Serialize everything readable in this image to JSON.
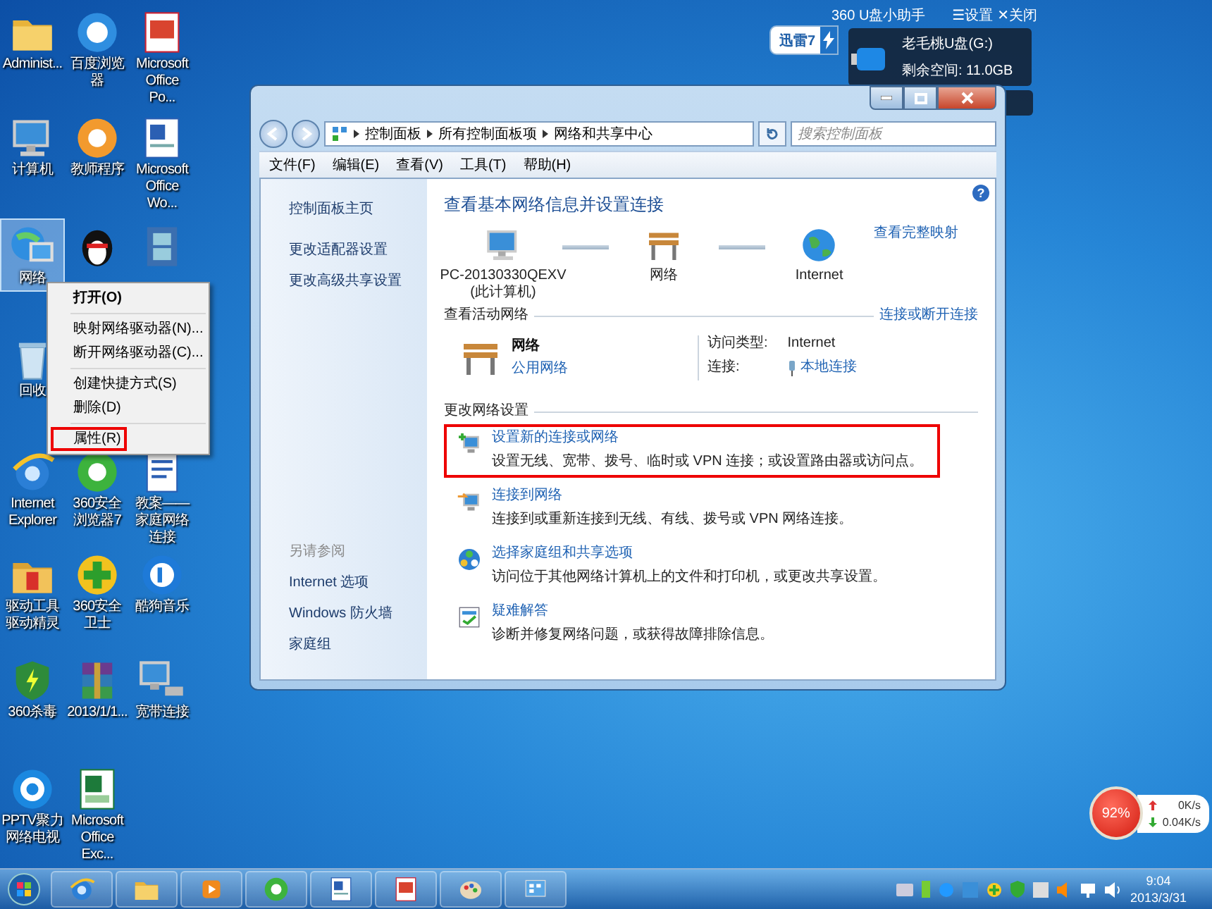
{
  "desktop_icons": [
    [
      {
        "label": "Administ...",
        "kind": "user-folder",
        "selected": false
      },
      {
        "label": "百度浏览器",
        "kind": "browser",
        "selected": false
      },
      {
        "label": "Microsoft Office Po...",
        "kind": "presentation",
        "selected": false
      }
    ],
    [
      {
        "label": "计算机",
        "kind": "computer",
        "selected": false
      },
      {
        "label": "教师程序",
        "kind": "app",
        "selected": false
      },
      {
        "label": "Microsoft Office Wo...",
        "kind": "word-document",
        "selected": false
      }
    ],
    [
      {
        "label": "网络",
        "kind": "network",
        "selected": true
      },
      {
        "kind": "qq",
        "selected": false
      },
      {
        "kind": "video",
        "selected": false
      }
    ],
    [
      {
        "label": "回收",
        "kind": "recycle-bin",
        "selected": false
      }
    ],
    [
      {
        "label": "Internet Explorer",
        "kind": "ie",
        "selected": false
      },
      {
        "label": "360安全浏览器7",
        "kind": "green-browser",
        "selected": false
      },
      {
        "label": "教案——家庭网络连接",
        "kind": "document",
        "selected": false
      }
    ],
    [
      {
        "label": "驱动工具驱动精灵",
        "kind": "driver-tool",
        "selected": false
      },
      {
        "label": "360安全卫士",
        "kind": "security",
        "selected": false
      },
      {
        "label": "酷狗音乐",
        "kind": "music",
        "selected": false
      }
    ],
    [
      {
        "label": "360杀毒",
        "kind": "antivirus",
        "selected": false
      },
      {
        "label": "2013/1/1...",
        "kind": "archive",
        "selected": false
      },
      {
        "label": "宽带连接",
        "kind": "broadband",
        "selected": false
      }
    ],
    [
      {
        "label": "PPTV聚力网络电视",
        "kind": "tv",
        "selected": false
      },
      {
        "label": "Microsoft Office Exc...",
        "kind": "spreadsheet",
        "selected": false
      }
    ]
  ],
  "context_menu": {
    "groups": [
      [
        {
          "label": "打开(O)",
          "default": true,
          "highlighted": false
        }
      ],
      [
        {
          "label": "映射网络驱动器(N)...",
          "default": false,
          "highlighted": false
        },
        {
          "label": "断开网络驱动器(C)...",
          "default": false,
          "highlighted": false
        }
      ],
      [
        {
          "label": "创建快捷方式(S)",
          "default": false,
          "highlighted": false
        },
        {
          "label": "删除(D)",
          "default": false,
          "highlighted": false
        }
      ],
      [
        {
          "label": "属性(R)",
          "default": false,
          "highlighted": true
        }
      ]
    ]
  },
  "window": {
    "breadcrumb": [
      "控制面板",
      "所有控制面板项",
      "网络和共享中心"
    ],
    "search": {
      "placeholder": "搜索控制面板"
    },
    "menu": [
      "文件(F)",
      "编辑(E)",
      "查看(V)",
      "工具(T)",
      "帮助(H)"
    ],
    "help_button": "?",
    "sidebar": {
      "links": [
        "控制面板主页",
        "更改适配器设置",
        "更改高级共享设置"
      ],
      "see_also_title": "另请参阅",
      "see_also": [
        "Internet 选项",
        "Windows 防火墙",
        "家庭组"
      ]
    },
    "heading": "查看基本网络信息并设置连接",
    "network_map": {
      "nodes": [
        {
          "kind": "computer",
          "label": "PC-20130330QEXV",
          "sublabel": "(此计算机)"
        },
        {
          "kind": "bench",
          "label": "网络"
        },
        {
          "kind": "globe",
          "label": "Internet"
        }
      ],
      "link": "查看完整映射"
    },
    "active_networks": {
      "title": "查看活动网络",
      "link": "连接或断开连接",
      "name": "网络",
      "type_link": "公用网络",
      "access_label": "访问类型:",
      "access_value": "Internet",
      "connection_label": "连接:",
      "connection_link": "本地连接"
    },
    "change_settings": {
      "title": "更改网络设置",
      "tasks": [
        {
          "kind": "new-connection",
          "title": "设置新的连接或网络",
          "description": "设置无线、宽带、拨号、临时或 VPN 连接；或设置路由器或访问点。",
          "highlighted": true
        },
        {
          "kind": "connect",
          "title": "连接到网络",
          "description": "连接到或重新连接到无线、有线、拨号或 VPN 网络连接。",
          "highlighted": false
        },
        {
          "kind": "homegroup",
          "title": "选择家庭组和共享选项",
          "description": "访问位于其他网络计算机上的文件和打印机，或更改共享设置。",
          "highlighted": false
        },
        {
          "kind": "troubleshoot",
          "title": "疑难解答",
          "description": "诊断并修复网络问题，或获得故障排除信息。",
          "highlighted": false
        }
      ]
    }
  },
  "thunder_badge": "迅雷7",
  "usb_helper": {
    "title": "360 U盘小助手",
    "settings": "☰设置",
    "close": "✕关闭",
    "drive": "老毛桃U盘(G:)",
    "free_space": "剩余空间: 11.0GB"
  },
  "net_meter": {
    "percent": "92%",
    "upload": "0K/s",
    "download": "0.04K/s"
  },
  "taskbar": {
    "pinned": [
      {
        "kind": "ie"
      },
      {
        "kind": "folder"
      },
      {
        "kind": "media"
      },
      {
        "kind": "green-browser"
      },
      {
        "kind": "word-document"
      },
      {
        "kind": "presentation"
      },
      {
        "kind": "paint"
      },
      {
        "kind": "control-panel"
      }
    ],
    "clock": {
      "time": "9:04",
      "date": "2013/3/31"
    }
  }
}
